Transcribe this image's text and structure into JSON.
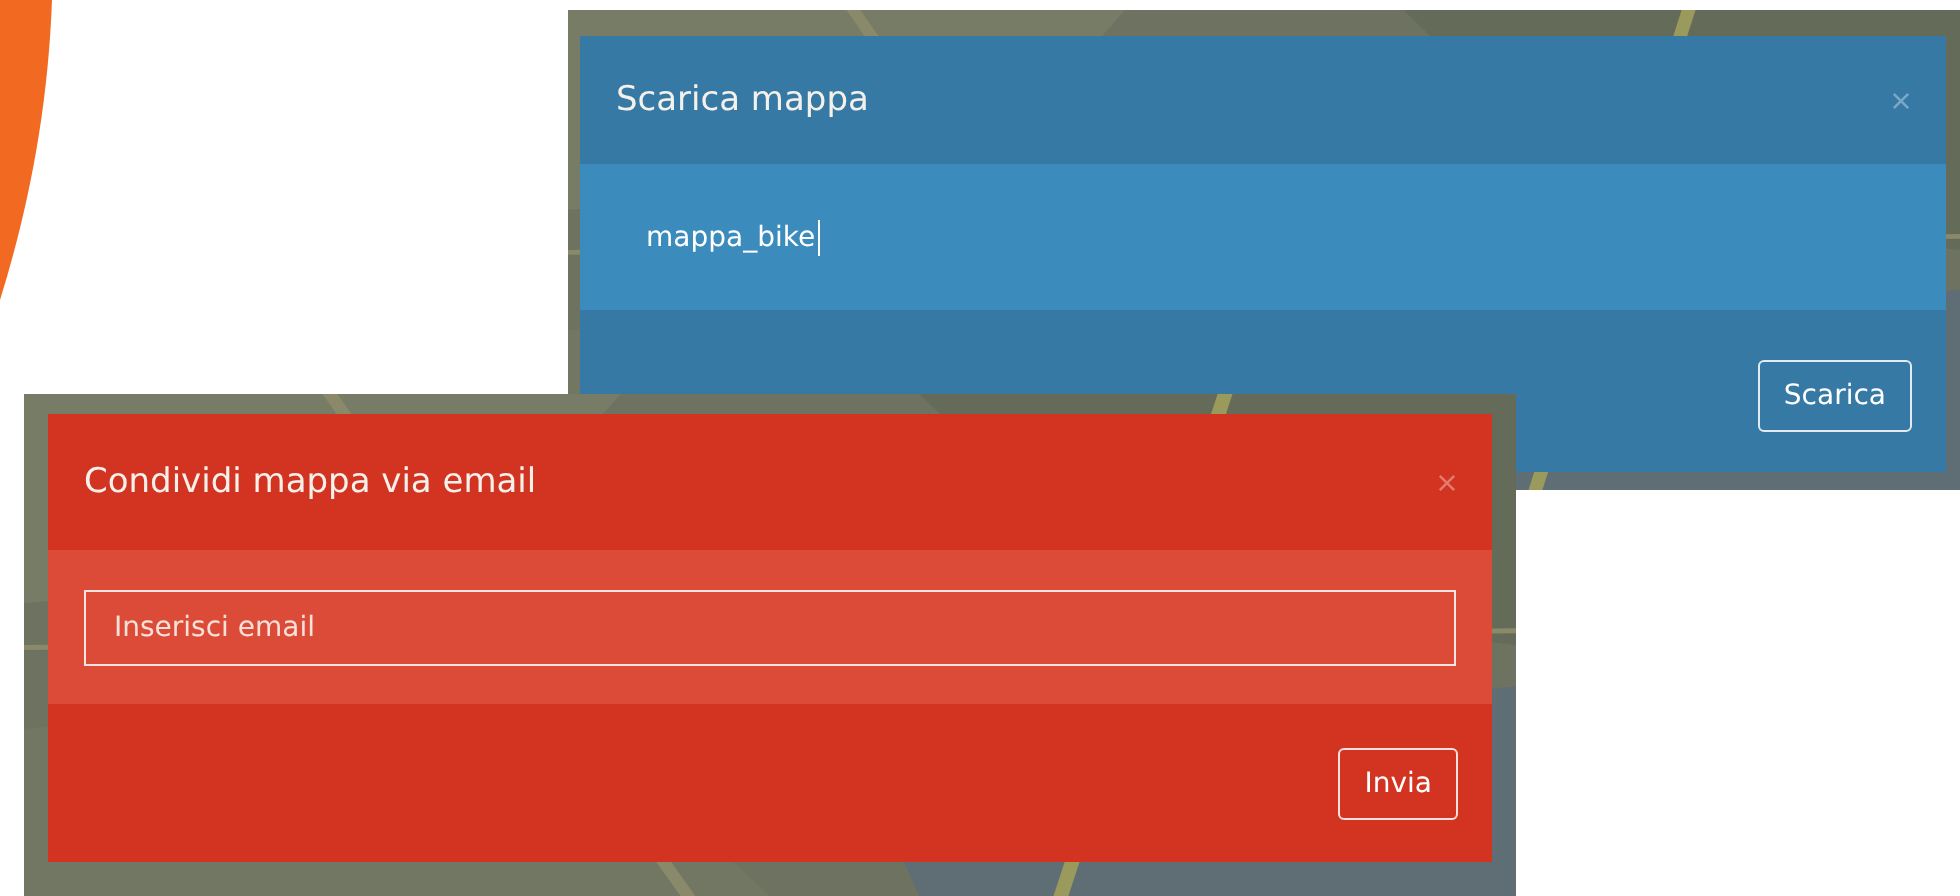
{
  "dialogs": [
    {
      "kind": "blue",
      "title": "Scarica mappa",
      "field": {
        "value": "mappa_bike",
        "focused": true
      },
      "button": "Scarica"
    },
    {
      "kind": "red",
      "title": "Condividi mappa via email",
      "field": {
        "placeholder": "Inserisci email",
        "focused": false
      },
      "button": "Invia"
    }
  ]
}
